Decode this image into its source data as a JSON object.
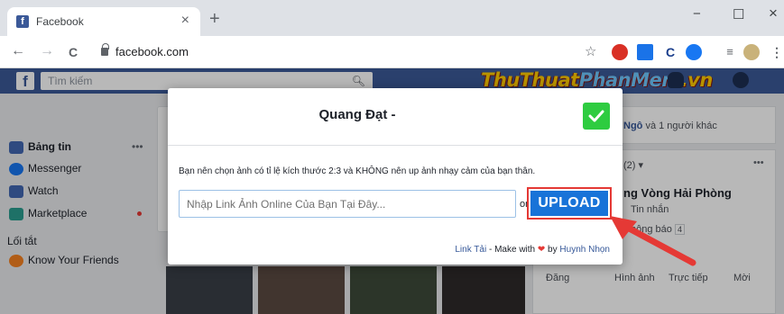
{
  "browser": {
    "tab_title": "Facebook",
    "tab_favicon": "f",
    "tab_close": "×",
    "new_tab": "+",
    "minimize": "−",
    "maximize": "☐",
    "close": "×",
    "url": "facebook.com",
    "back": "←",
    "forward": "→",
    "reload": "C",
    "bookmark": "☆"
  },
  "facebook": {
    "logo": "f",
    "search_placeholder": "Tìm kiếm",
    "brand_left": "ThuThuat",
    "brand_right": "PhanMem",
    "brand_tld": ".vn"
  },
  "sidebar": {
    "items": [
      {
        "label": "Bảng tin",
        "color": "#4267b2"
      },
      {
        "label": "Messenger",
        "color": "#1877f2"
      },
      {
        "label": "Watch",
        "color": "#4267b2"
      },
      {
        "label": "Marketplace",
        "color": "#2a9d8f"
      }
    ],
    "shortcuts_header": "Lối tắt",
    "shortcuts": [
      {
        "label": "Know Your Friends",
        "color": "#f58220"
      }
    ],
    "more": "•••"
  },
  "right": {
    "likes_text_name": "Ngô",
    "likes_text_rest": "và 1 người khác",
    "section_count": "(2) ▾",
    "page_name": "ng Vòng Hải Phòng",
    "messages": "Tin nhắn",
    "notifications": "hông báo",
    "notif_count": "4",
    "actions": [
      "Đăng",
      "Hình ảnh",
      "Trực tiếp",
      "Mời"
    ]
  },
  "modal": {
    "title": "Quang Đạt -",
    "hint": "Bạn nên chọn ảnh có tỉ lệ kích thước 2:3 và KHÔNG nên up ảnh nhạy cảm của bạn thân.",
    "input_placeholder": "Nhập Link Ảnh Online Của Bạn Tại Đây...",
    "or": "or",
    "upload_label": "UPLOAD",
    "footer_link": "Link Tải",
    "footer_mid": " - Make with ",
    "footer_heart": "❤",
    "footer_by": " by ",
    "footer_author": "Huynh Nhọn",
    "accent": "#1873d8",
    "confirm_color": "#2ecc40"
  }
}
